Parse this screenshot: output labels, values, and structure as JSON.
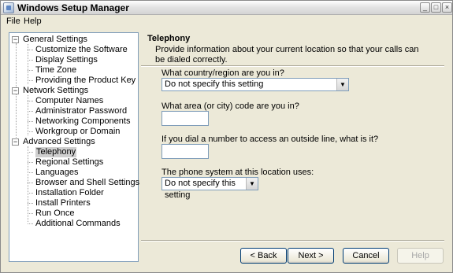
{
  "window": {
    "title": "Windows Setup Manager",
    "controls": {
      "minimize": "_",
      "maximize": "□",
      "close": "×"
    }
  },
  "menu": [
    "File",
    "Help"
  ],
  "tree": {
    "groups": [
      {
        "label": "General Settings",
        "expander": "−",
        "items": [
          "Customize the Software",
          "Display Settings",
          "Time Zone",
          "Providing the Product Key"
        ]
      },
      {
        "label": "Network Settings",
        "expander": "−",
        "items": [
          "Computer Names",
          "Administrator Password",
          "Networking Components",
          "Workgroup or Domain"
        ]
      },
      {
        "label": "Advanced Settings",
        "expander": "−",
        "items": [
          "Telephony",
          "Regional Settings",
          "Languages",
          "Browser and Shell Settings",
          "Installation Folder",
          "Install Printers",
          "Run Once",
          "Additional Commands"
        ]
      }
    ],
    "selected": "Telephony"
  },
  "page": {
    "heading": "Telephony",
    "description": "Provide information about your current location so that your calls can be dialed correctly.",
    "country": {
      "label": "What country/region are you in?",
      "value": "Do not specify this setting"
    },
    "area": {
      "label": "What area (or city) code are you in?",
      "value": ""
    },
    "outside": {
      "label": "If you dial a number to access an outside line, what is it?",
      "value": ""
    },
    "phone_system": {
      "label": "The phone system at this location uses:",
      "value": "Do not specify this setting"
    }
  },
  "buttons": {
    "back": "< Back",
    "next": "Next >",
    "cancel": "Cancel",
    "help": "Help"
  },
  "icons": {
    "app": "setup-manager-icon",
    "dropdown": "chevron-down-icon"
  }
}
